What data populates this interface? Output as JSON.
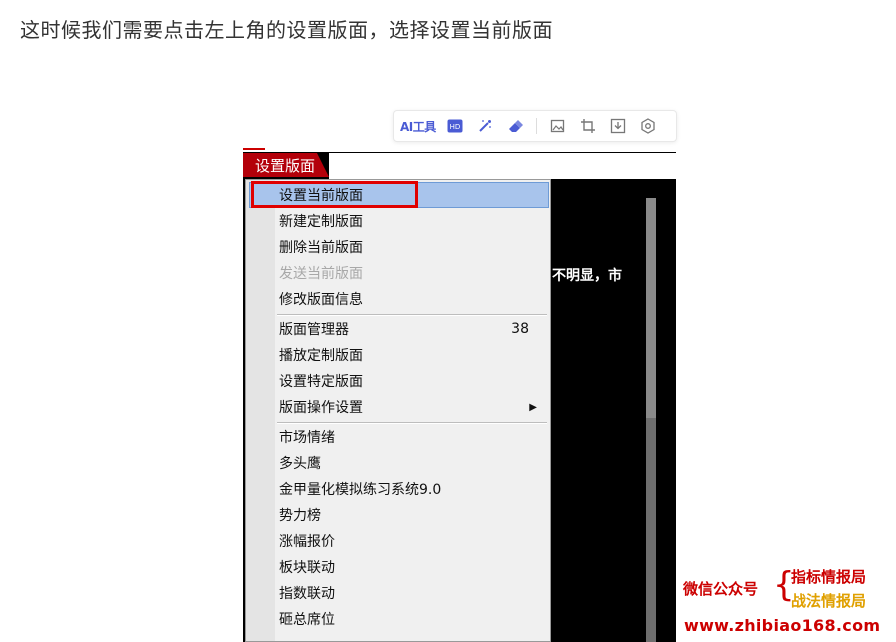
{
  "article": {
    "text": "这时候我们需要点击左上角的设置版面，选择设置当前版面"
  },
  "toolbar": {
    "ai_label": "AI工具",
    "icons": [
      "hd-icon",
      "magic-wand-icon",
      "eraser-icon",
      "image-edit-icon",
      "crop-icon",
      "download-icon",
      "settings-icon"
    ]
  },
  "app": {
    "menu_tab": "设置版面",
    "bg_text": "不明显，市"
  },
  "menu": {
    "group1": [
      "设置当前版面",
      "新建定制版面",
      "删除当前版面",
      "发送当前版面",
      "修改版面信息"
    ],
    "group2": [
      "版面管理器",
      "播放定制版面",
      "设置特定版面",
      "版面操作设置"
    ],
    "group2_shortcut": "38",
    "group3": [
      "市场情绪",
      "多头鹰",
      "金甲量化模拟练习系统9.0",
      "势力榜",
      "涨幅报价",
      "板块联动",
      "指数联动",
      "砸总席位"
    ],
    "disabled_item": "发送当前版面"
  },
  "watermark": {
    "left": "微信公众号",
    "right1": "指标情报局",
    "right2": "战法情报局",
    "url": "www.zhibiao168.com"
  },
  "colors": {
    "accent_red": "#b3000a",
    "highlight": "#a8c4ec",
    "watermark_gold": "#e0a000"
  }
}
